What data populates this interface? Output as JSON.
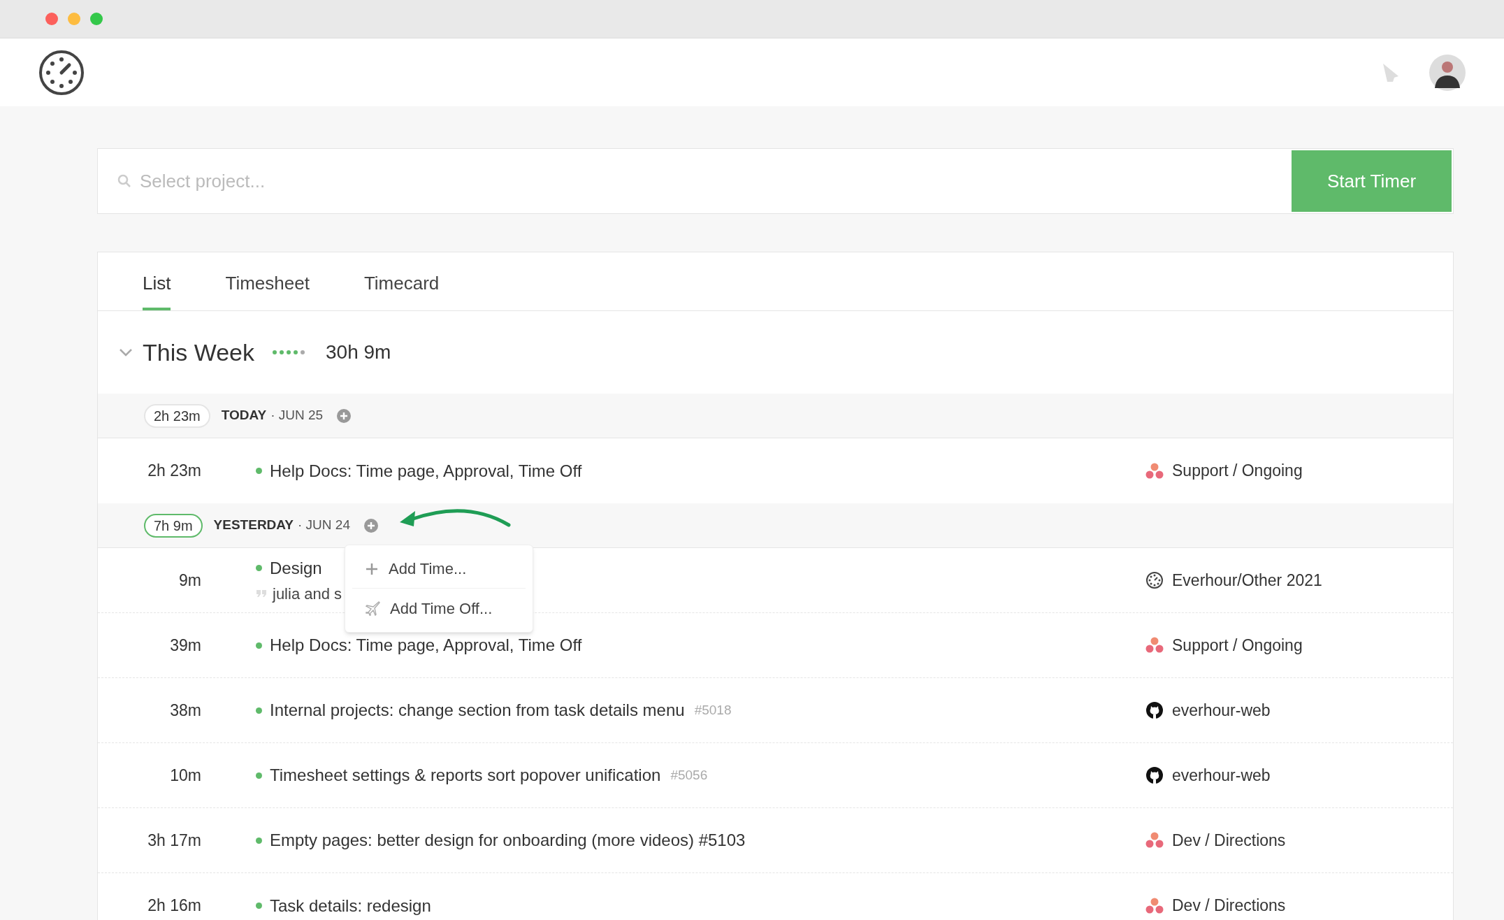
{
  "search": {
    "placeholder": "Select project..."
  },
  "start_button": "Start Timer",
  "tabs": [
    {
      "label": "List",
      "selected": true
    },
    {
      "label": "Timesheet",
      "selected": false
    },
    {
      "label": "Timecard",
      "selected": false
    }
  ],
  "week": {
    "title": "This Week",
    "total": "30h 9m",
    "expanded": true
  },
  "days": [
    {
      "total": "2h 23m",
      "label": "TODAY",
      "date": "· JUN 25",
      "selected": false,
      "entries": [
        {
          "duration": "2h 23m",
          "title": "Help Docs: Time page, Approval, Time Off",
          "project": {
            "name": "Support / Ongoing",
            "kind": "asana"
          }
        }
      ]
    },
    {
      "total": "7h 9m",
      "label": "YESTERDAY",
      "date": "· JUN 24",
      "selected": true,
      "entries": [
        {
          "duration": "9m",
          "title": "Design",
          "comment": "julia and s",
          "project": {
            "name": "Everhour/Other 2021",
            "kind": "everhour"
          }
        },
        {
          "duration": "39m",
          "title": "Help Docs: Time page, Approval, Time Off",
          "project": {
            "name": "Support / Ongoing",
            "kind": "asana"
          }
        },
        {
          "duration": "38m",
          "title": "Internal projects: change section from task details menu",
          "ref": "#5018",
          "project": {
            "name": "everhour-web",
            "kind": "github"
          }
        },
        {
          "duration": "10m",
          "title": "Timesheet settings & reports sort popover unification",
          "ref": "#5056",
          "project": {
            "name": "everhour-web",
            "kind": "github"
          }
        },
        {
          "duration": "3h 17m",
          "title": "Empty pages: better design for onboarding (more videos) #5103",
          "project": {
            "name": "Dev / Directions",
            "kind": "asana"
          }
        },
        {
          "duration": "2h 16m",
          "title": "Task details: redesign",
          "project": {
            "name": "Dev / Directions",
            "kind": "asana"
          }
        }
      ]
    }
  ],
  "menu": {
    "items": [
      {
        "label": "Add Time...",
        "kind": "add"
      },
      {
        "label": "Add Time Off...",
        "kind": "timeoff"
      }
    ]
  }
}
